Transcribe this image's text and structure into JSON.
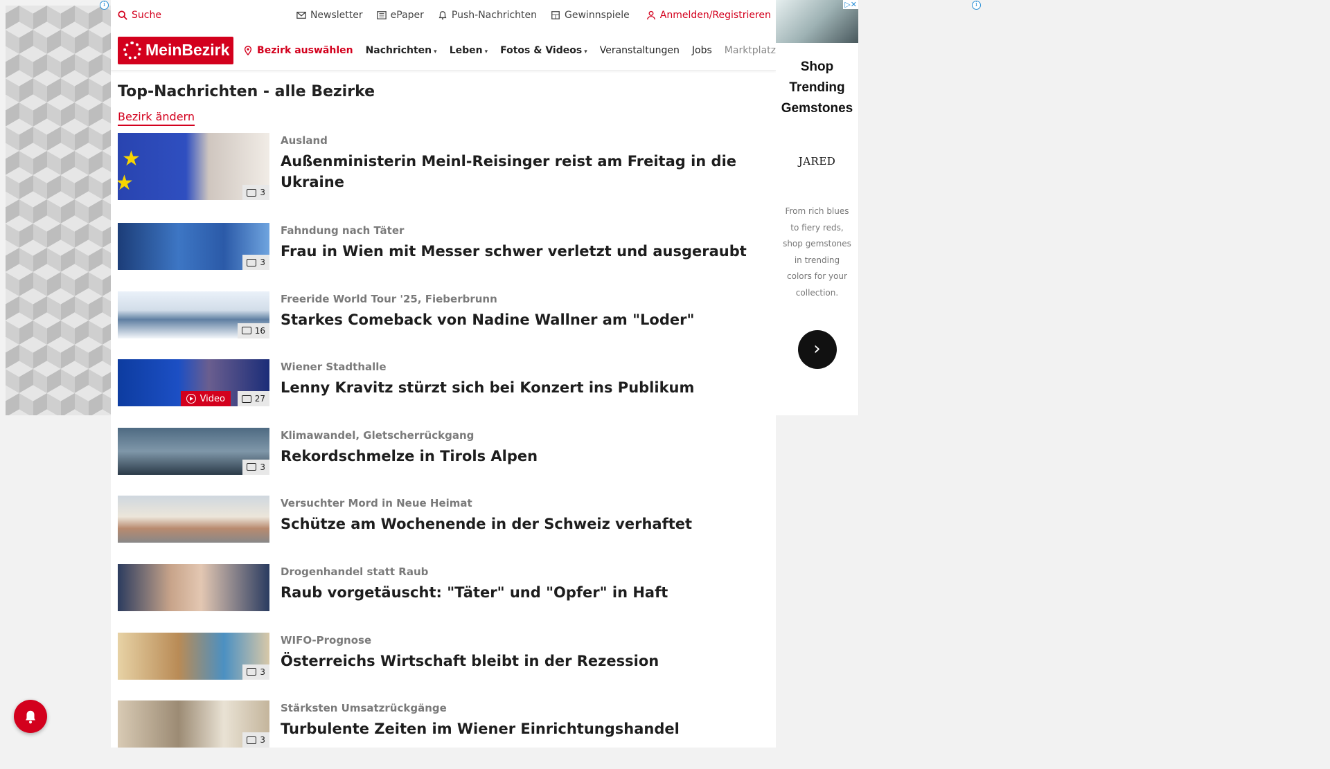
{
  "topbar": {
    "search": "Suche",
    "newsletter": "Newsletter",
    "epaper": "ePaper",
    "push": "Push-Nachrichten",
    "gewinnspiele": "Gewinnspiele",
    "login": "Anmelden/Registrieren"
  },
  "navbar": {
    "logo": "MeinBezirk",
    "bezirk": "Bezirk auswählen",
    "items": [
      "Nachrichten",
      "Leben",
      "Fotos & Videos",
      "Veranstaltungen",
      "Jobs",
      "Marktplatz"
    ]
  },
  "page": {
    "title": "Top-Nachrichten - alle Bezirke",
    "change_bezirk": "Bezirk ändern"
  },
  "articles": [
    {
      "kicker": "Ausland",
      "headline": "Außenministerin Meinl-Reisinger reist am Freitag in die Ukraine",
      "photos": "3"
    },
    {
      "kicker": "Fahndung nach Täter",
      "headline": "Frau in Wien mit Messer schwer verletzt und ausgeraubt",
      "photos": "3"
    },
    {
      "kicker": "Freeride World Tour '25, Fieberbrunn",
      "headline": "Starkes Comeback von Nadine Wallner am \"Loder\"",
      "photos": "16"
    },
    {
      "kicker": "Wiener Stadthalle",
      "headline": "Lenny Kravitz stürzt sich bei Konzert ins Publikum",
      "photos": "27",
      "video": "Video"
    },
    {
      "kicker": "Klimawandel, Gletscherrückgang",
      "headline": "Rekordschmelze in Tirols Alpen",
      "photos": "3"
    },
    {
      "kicker": "Versuchter Mord in Neue Heimat",
      "headline": "Schütze am Wochenende in der Schweiz verhaftet",
      "photos": ""
    },
    {
      "kicker": "Drogenhandel statt Raub",
      "headline": "Raub vorgetäuscht: \"Täter\" und \"Opfer\" in Haft",
      "photos": ""
    },
    {
      "kicker": "WIFO-Prognose",
      "headline": "Österreichs Wirtschaft bleibt in der Rezession",
      "photos": "3"
    },
    {
      "kicker": "Stärksten Umsatzrückgänge",
      "headline": "Turbulente Zeiten im Wiener Einrichtungshandel",
      "photos": "3"
    }
  ],
  "ad": {
    "headline_line1": "Shop",
    "headline_line2": "Trending",
    "headline_line3": "Gemstones",
    "brand": "JARED",
    "copy": "From rich blues to fiery reds, shop gemstones in trending colors for your collection.",
    "cta": "›",
    "badge": "▷✕"
  },
  "icons": {
    "search": "search-icon",
    "newsletter": "mail-icon",
    "epaper": "newspaper-icon",
    "push": "bell-icon",
    "gewinnspiele": "gift-icon",
    "login": "user-icon",
    "location": "map-pin-icon",
    "photos": "camera-icon",
    "video": "play-icon",
    "notification": "bell-icon"
  },
  "colors": {
    "brand": "#d3001d",
    "kicker": "#7a7a7a",
    "info": "#2a8fd6"
  }
}
